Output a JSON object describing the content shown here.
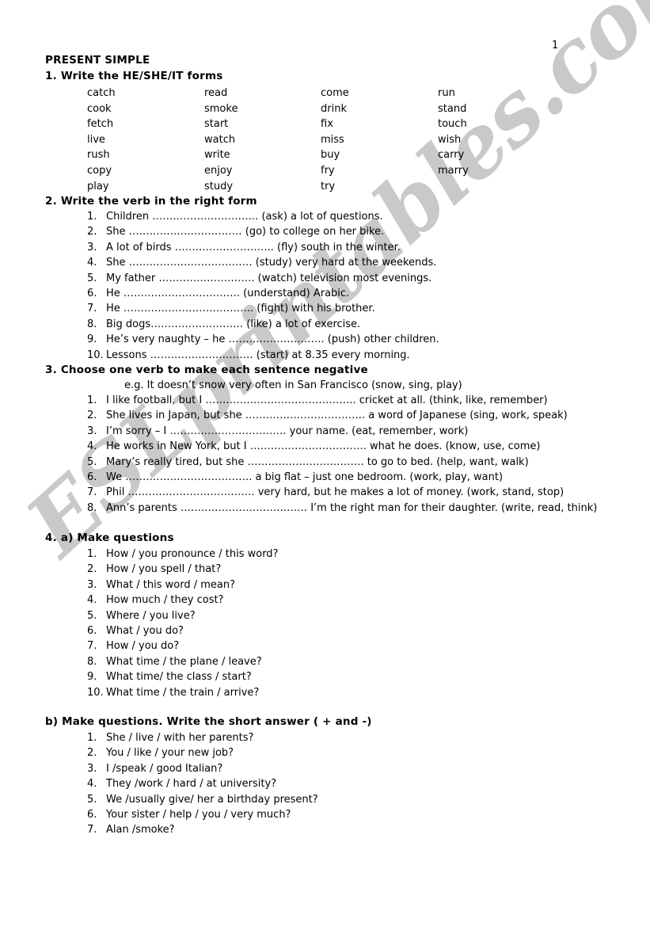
{
  "page": {
    "number": "1",
    "title": "PRESENT SIMPLE",
    "watermark": "ESLprintables.com"
  },
  "sections": {
    "s1": {
      "heading": "1. Write the HE/SHE/IT forms",
      "columns": [
        [
          "catch",
          "cook",
          "fetch",
          "live",
          "rush",
          "copy",
          "play"
        ],
        [
          "read",
          "smoke",
          "start",
          "watch",
          "write",
          "enjoy",
          "study"
        ],
        [
          "come",
          "drink",
          "fix",
          "miss",
          "buy",
          "fry",
          "try"
        ],
        [
          "run",
          "stand",
          "touch",
          "wish",
          "carry",
          "marry"
        ]
      ]
    },
    "s2": {
      "heading": "2. Write the verb in the right form",
      "items": [
        {
          "num": "1.",
          "text": "Children …………………………. (ask) a lot of questions."
        },
        {
          "num": "2.",
          "text": "She …………………………… (go) to college on her bike."
        },
        {
          "num": "3.",
          "text": "A lot of birds ……………………….. (fly) south in the winter."
        },
        {
          "num": "4.",
          "text": "She ……………………………… (study) very hard at the weekends."
        },
        {
          "num": "5.",
          "text": "My father ………………………. (watch) television most evenings."
        },
        {
          "num": "6.",
          "text": "He ……………………………. (understand) Arabic."
        },
        {
          "num": "7.",
          "text": "He ……………………………….. (fight) with his brother."
        },
        {
          "num": "8.",
          "text": "Big dogs……………………… (like) a lot of exercise."
        },
        {
          "num": "9.",
          "text": "He’s very naughty – he ………………………. (push)  other children."
        },
        {
          "num": "10.",
          "text": "Lessons ………………………… (start) at 8.35 every morning."
        }
      ]
    },
    "s3": {
      "heading": "3. Choose one verb to make each sentence negative",
      "example": "e.g. It doesn’t snow very often in San Francisco (snow, sing, play)",
      "items": [
        {
          "num": "1.",
          "text": "I like football, but I …………………………………….. cricket at all. (think, like, remember)"
        },
        {
          "num": "2.",
          "text": "She lives in Japan, but she …………………………….. a word of Japanese (sing, work, speak)"
        },
        {
          "num": "3.",
          "text": "I’m sorry – I ……………………………. your name. (eat, remember, work)"
        },
        {
          "num": "4.",
          "text": "He works in New York, but I ……………………………. what he does. (know, use, come)"
        },
        {
          "num": "5.",
          "text": "Mary’s really tired, but she ……………………………. to go to bed. (help, want, walk)"
        },
        {
          "num": "6.",
          "text": "We ………………………………. a big flat – just one bedroom. (work, play, want)"
        },
        {
          "num": "7.",
          "text": "Phil ………………………………. very hard, but he makes a lot of money. (work, stand, stop)"
        },
        {
          "num": "8.",
          "text": "Ann’s parents ………………………………. I’m the right man for their daughter. (write, read, think)"
        }
      ]
    },
    "s4a": {
      "heading": "4. a) Make questions",
      "items": [
        {
          "num": "1.",
          "text": "How / you pronounce / this word?"
        },
        {
          "num": "2.",
          "text": "How / you spell / that?"
        },
        {
          "num": "3.",
          "text": "What / this word / mean?"
        },
        {
          "num": "4.",
          "text": "How much / they cost?"
        },
        {
          "num": "5.",
          "text": "Where / you live?"
        },
        {
          "num": "6.",
          "text": "What / you do?"
        },
        {
          "num": "7.",
          "text": "How / you do?"
        },
        {
          "num": "8.",
          "text": "What time / the plane / leave?"
        },
        {
          "num": "9.",
          "text": "What time/ the class / start?"
        },
        {
          "num": "10.",
          "text": "What time / the train / arrive?"
        }
      ]
    },
    "s4b": {
      "heading": "b) Make questions. Write the short answer ( + and -)",
      "items": [
        {
          "num": "1.",
          "text": "She / live / with her parents?"
        },
        {
          "num": "2.",
          "text": "You / like / your new job?"
        },
        {
          "num": "3.",
          "text": "I /speak / good Italian?"
        },
        {
          "num": "4.",
          "text": "They /work / hard / at university?"
        },
        {
          "num": "5.",
          "text": "We /usually give/ her a birthday present?"
        },
        {
          "num": "6.",
          "text": "Your sister / help / you / very much?"
        },
        {
          "num": "7.",
          "text": "Alan /smoke?"
        }
      ]
    }
  }
}
